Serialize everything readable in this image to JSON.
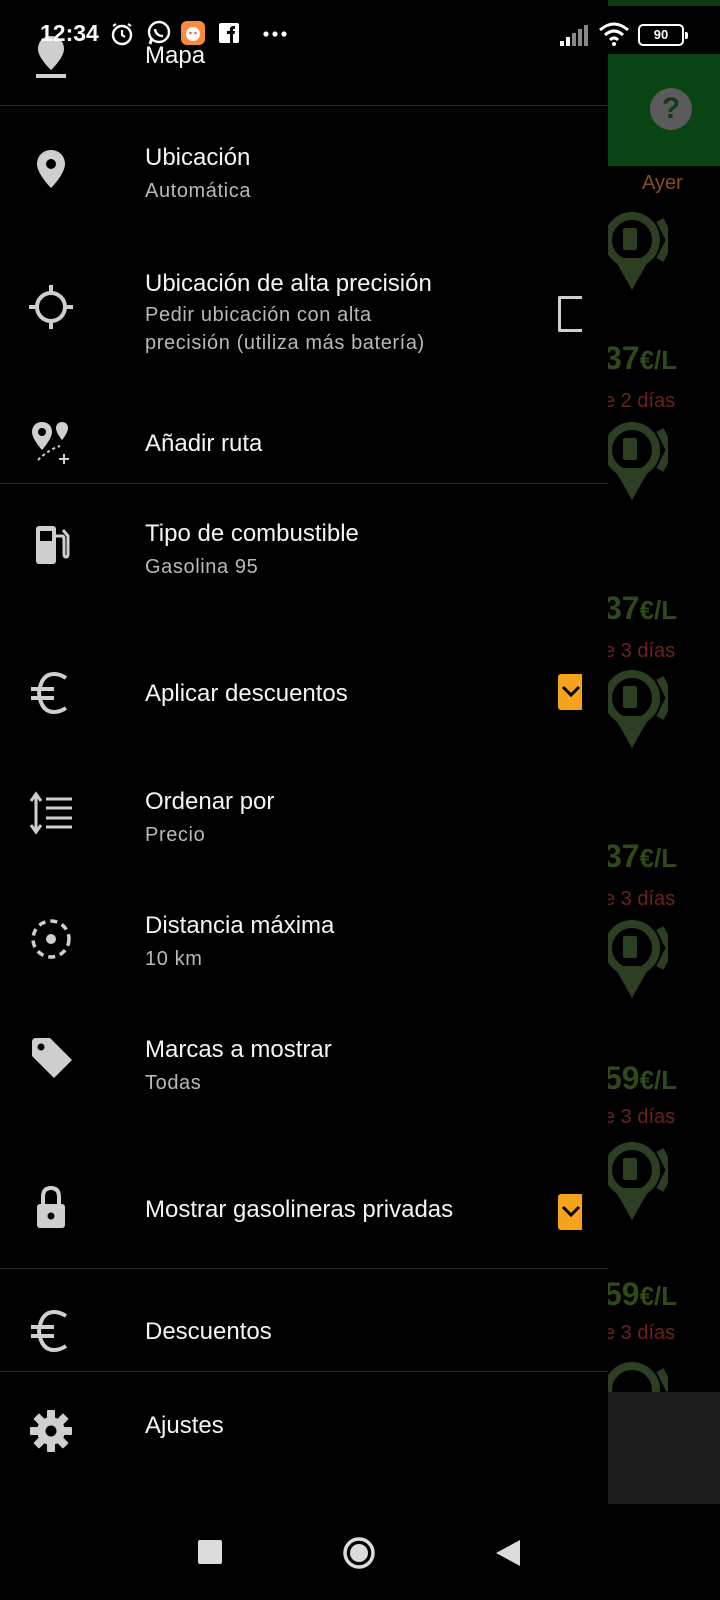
{
  "status_bar": {
    "time": "12:34",
    "battery": "90",
    "notification_icons": [
      "alarm-icon",
      "whatsapp-icon",
      "app-icon",
      "facebook-icon",
      "more-icon"
    ],
    "system_icons": [
      "signal-icon",
      "wifi-icon",
      "battery-icon"
    ]
  },
  "background_app": {
    "help_label": "?",
    "yesterday_label": "Ayer",
    "prices": [
      {
        "price": "37",
        "unit": "€/L",
        "ago": "e 2 días"
      },
      {
        "price": "37",
        "unit": "€/L",
        "ago": "e 3 días"
      },
      {
        "price": "37",
        "unit": "€/L",
        "ago": "e 3 días"
      },
      {
        "price": "59",
        "unit": "€/L",
        "ago": "e 3 días"
      },
      {
        "price": "59",
        "unit": "€/L",
        "ago": "e 3 días"
      }
    ]
  },
  "drawer": {
    "items": [
      {
        "title": "Mapa",
        "icon": "map-icon"
      },
      {
        "title": "Ubicación",
        "subtitle": "Automática",
        "icon": "location-pin-icon"
      },
      {
        "title": "Ubicación de alta precisión",
        "subtitle_line1": "Pedir ubicación con alta",
        "subtitle_line2": "precisión (utiliza más batería)",
        "icon": "crosshair-icon",
        "checked": false
      },
      {
        "title": "Añadir ruta",
        "icon": "add-route-icon"
      },
      {
        "title": "Tipo de combustible",
        "subtitle": "Gasolina 95",
        "icon": "fuel-pump-icon"
      },
      {
        "title": "Aplicar descuentos",
        "icon": "euro-icon",
        "checked": true
      },
      {
        "title": "Ordenar por",
        "subtitle": "Precio",
        "icon": "sort-icon"
      },
      {
        "title": "Distancia máxima",
        "subtitle": "10 km",
        "icon": "radius-icon"
      },
      {
        "title": "Marcas a mostrar",
        "subtitle": "Todas",
        "icon": "tag-icon"
      },
      {
        "title": "Mostrar gasolineras privadas",
        "icon": "lock-icon",
        "checked": true
      },
      {
        "title": "Descuentos",
        "icon": "euro-icon"
      },
      {
        "title": "Ajustes",
        "icon": "gear-icon"
      }
    ]
  },
  "colors": {
    "accent": "#f6a21c",
    "header_green": "#0b4414",
    "price_green": "#2f4a1a",
    "ago_red": "#6a2418"
  }
}
